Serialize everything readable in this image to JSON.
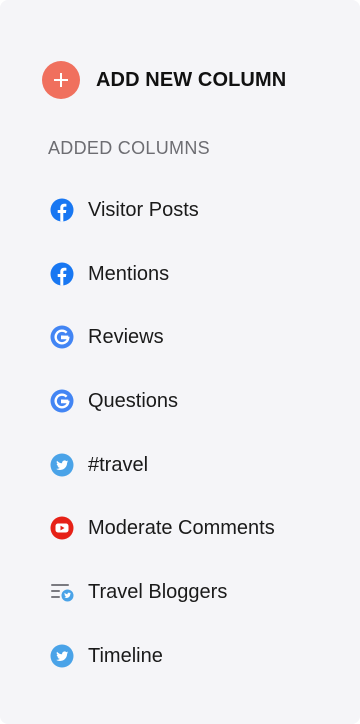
{
  "add_column": {
    "label": "ADD NEW COLUMN",
    "button_color": "#f0705e"
  },
  "section": {
    "heading": "ADDED COLUMNS"
  },
  "columns": [
    {
      "label": "Visitor Posts",
      "icon": "facebook-icon"
    },
    {
      "label": "Mentions",
      "icon": "facebook-icon"
    },
    {
      "label": "Reviews",
      "icon": "google-icon"
    },
    {
      "label": "Questions",
      "icon": "google-icon"
    },
    {
      "label": "#travel",
      "icon": "twitter-icon"
    },
    {
      "label": "Moderate Comments",
      "icon": "youtube-icon"
    },
    {
      "label": "Travel Bloggers",
      "icon": "twitter-list-icon"
    },
    {
      "label": "Timeline",
      "icon": "twitter-icon"
    }
  ],
  "colors": {
    "facebook": "#1877f2",
    "google": "#4285f4",
    "twitter": "#4aa3e8",
    "youtube": "#e62117",
    "background": "#f5f5f8"
  }
}
